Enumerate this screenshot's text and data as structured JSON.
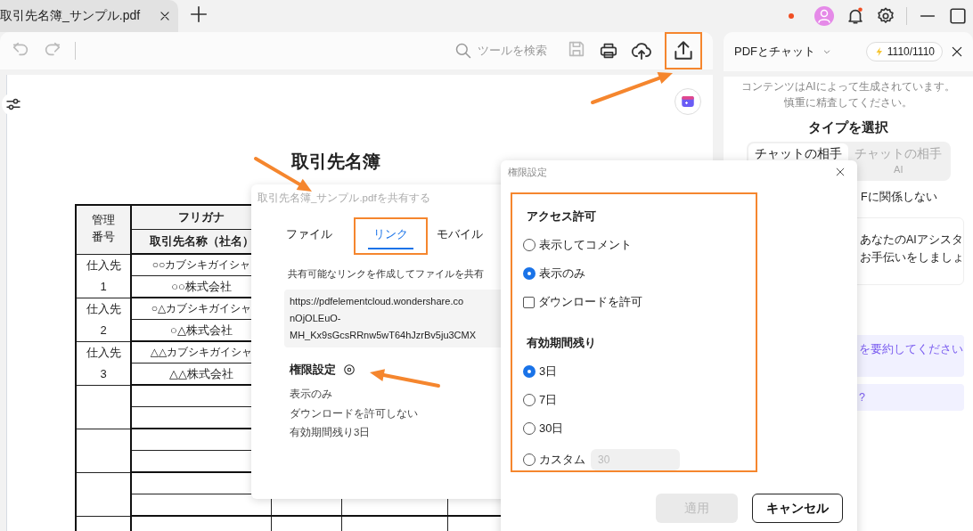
{
  "tab": {
    "title": "取引先名簿_サンプル.pdf"
  },
  "toolbar": {
    "search_placeholder": "ツールを検索"
  },
  "chat_panel": {
    "mode": "PDFとチャット",
    "credits": "1110/1110",
    "disclaimer": "コンテンツはAIによって生成されています。慎重に精査してください。",
    "type_heading": "タイプを選択",
    "types": [
      {
        "label": "チャットの相手",
        "selected": true
      },
      {
        "label": "チャットの相手",
        "sublabel": "AI",
        "selected": false
      }
    ],
    "type_note": "Fに関係しない",
    "greeting": [
      "あなたのAIアシスタ",
      "お手伝いをしましょ"
    ],
    "suggestions": [
      "を要約してください",
      "?"
    ]
  },
  "document": {
    "title": "取引先名簿",
    "header": {
      "id": "管理番号",
      "furigana": "フリガナ",
      "name": "取引先名称（社名）"
    },
    "rows": [
      {
        "label": "仕入先",
        "number": "1",
        "furigana": "○○カブシキガイシャ",
        "name": "○○株式会社"
      },
      {
        "label": "仕入先",
        "number": "2",
        "furigana": "○△カブシキガイシャ",
        "name": "○△株式会社"
      },
      {
        "label": "仕入先",
        "number": "3",
        "furigana": "△△カブシキガイシャ",
        "name": "△△株式会社"
      }
    ]
  },
  "share_dialog": {
    "title": "取引先名簿_サンプル.pdfを共有する",
    "tabs": [
      {
        "label": "ファイル",
        "selected": false
      },
      {
        "label": "リンク",
        "selected": true
      },
      {
        "label": "モバイル",
        "selected": false
      }
    ],
    "description": "共有可能なリンクを作成してファイルを共有",
    "link_lines": [
      "https://pdfelementcloud.wondershare.co",
      "nOjOLEuO-",
      "MH_Kx9sGcsRRnw5wT64hJzrBv5ju3CMX"
    ],
    "permissions_heading": "権限設定",
    "summary": [
      "表示のみ",
      "ダウンロードを許可しない",
      "有効期間残り3日"
    ]
  },
  "permission_dialog": {
    "title": "権限設定",
    "sections": [
      {
        "heading": "アクセス許可",
        "options": [
          {
            "kind": "radio",
            "label": "表示してコメント",
            "selected": false
          },
          {
            "kind": "radio",
            "label": "表示のみ",
            "selected": true
          },
          {
            "kind": "checkbox",
            "label": "ダウンロードを許可",
            "checked": false
          }
        ]
      },
      {
        "heading": "有効期間残り",
        "options": [
          {
            "kind": "radio",
            "label": "3日",
            "selected": true
          },
          {
            "kind": "radio",
            "label": "7日",
            "selected": false
          },
          {
            "kind": "radio",
            "label": "30日",
            "selected": false
          },
          {
            "kind": "custom",
            "label": "カスタム",
            "selected": false,
            "value": "30",
            "disabled": true
          }
        ]
      }
    ],
    "buttons": [
      {
        "kind": "primary",
        "label": "適用",
        "disabled": true
      },
      {
        "kind": "secondary",
        "label": "キャンセル",
        "disabled": false
      }
    ]
  }
}
